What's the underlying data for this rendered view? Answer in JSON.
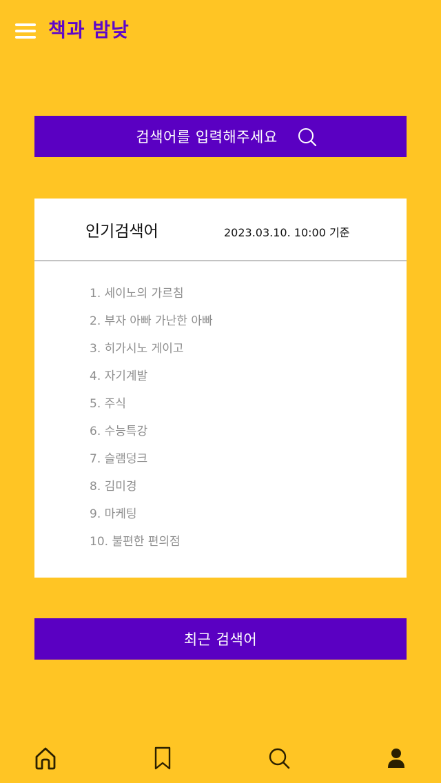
{
  "header": {
    "title": "책과 밤낮",
    "menu_icon": "hamburger-menu-icon"
  },
  "search": {
    "label": "검색어를 입력해주세요",
    "icon": "search-icon"
  },
  "popular": {
    "title": "인기검색어",
    "timestamp": "2023.03.10. 10:00 기준",
    "items": [
      "1. 세이노의 가르침",
      "2. 부자 아빠 가난한 아빠",
      "3. 히가시노 게이고",
      "4. 자기계발",
      "5. 주식",
      "6. 수능특강",
      "7. 슬램덩크",
      "8. 김미경",
      "9. 마케팅",
      "10. 불편한 편의점"
    ]
  },
  "recent": {
    "label": "최근 검색어"
  },
  "bottom_nav": {
    "items": [
      "home-icon",
      "bookmark-icon",
      "search-icon",
      "profile-icon"
    ]
  },
  "colors": {
    "background": "#FFC524",
    "accent": "#5A00C2",
    "title": "#5E07C9",
    "list_text": "#8E8E8E"
  }
}
